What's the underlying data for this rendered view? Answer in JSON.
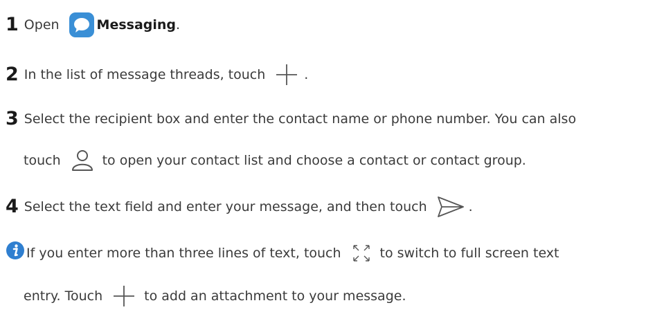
{
  "steps": [
    {
      "number": "1",
      "text_open": "Open",
      "app_name": "Messaging",
      "text_end": "."
    },
    {
      "number": "2",
      "text_before": "In the list of message threads, touch",
      "text_end": "."
    },
    {
      "number": "3",
      "text_line1": "Select the recipient box and enter the contact name or phone number. You can also",
      "text_line2_before": "touch",
      "text_line2_after": "to open your contact list and choose a contact or contact group."
    },
    {
      "number": "4",
      "text_before": "Select the text field and enter your message, and then touch",
      "text_end": "."
    }
  ],
  "note": {
    "line1_before": "If you enter more than three lines of text, touch",
    "line1_after": "to switch to full screen text",
    "line2_before": "entry. Touch",
    "line2_after": "to add an attachment to your message."
  },
  "icons": {
    "messaging_app": "messaging-app-icon",
    "add": "plus-icon",
    "contacts": "person-icon",
    "send": "send-icon",
    "fullscreen": "expand-icon",
    "info": "info-icon"
  },
  "colors": {
    "app_icon_bg": "#3a8fd6",
    "info_icon": "#2f7fd0",
    "text": "#3a3a3a",
    "icon_stroke": "#555555"
  }
}
